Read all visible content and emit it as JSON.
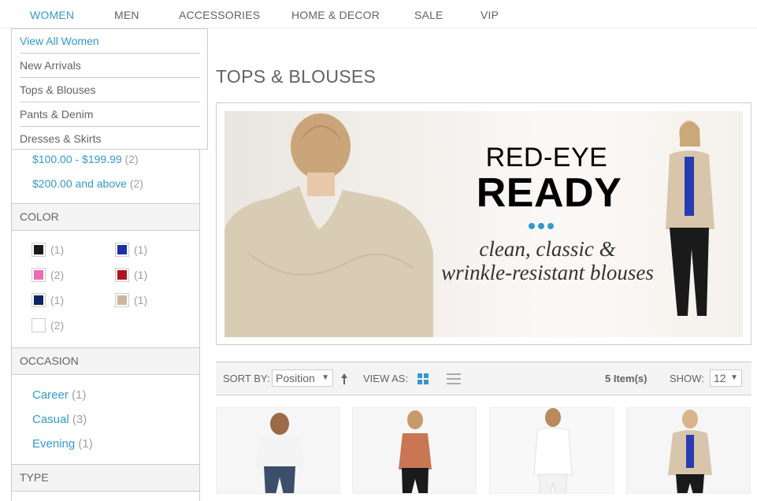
{
  "nav": {
    "items": [
      {
        "label": "WOMEN"
      },
      {
        "label": "MEN"
      },
      {
        "label": "ACCESSORIES"
      },
      {
        "label": "HOME & DECOR"
      },
      {
        "label": "SALE"
      },
      {
        "label": "VIP"
      }
    ],
    "active": "WOMEN"
  },
  "dropdown": {
    "items": [
      {
        "label": "View All Women"
      },
      {
        "label": "New Arrivals"
      },
      {
        "label": "Tops & Blouses"
      },
      {
        "label": "Pants & Denim"
      },
      {
        "label": "Dresses & Skirts"
      }
    ]
  },
  "sidebar": {
    "price": [
      {
        "label": "$100.00 - $199.99",
        "count": "(2)"
      },
      {
        "label": "$200.00 and above",
        "count": "(2)"
      }
    ],
    "color": {
      "title": "COLOR",
      "swatches": [
        {
          "color": "#1a1a1a",
          "count": "(1)"
        },
        {
          "color": "#1a2fa8",
          "count": "(1)"
        },
        {
          "color": "#f06ab4",
          "count": "(2)"
        },
        {
          "color": "#b0141e",
          "count": "(1)"
        },
        {
          "color": "#0f2466",
          "count": "(1)"
        },
        {
          "color": "#cbb89c",
          "count": "(1)"
        },
        {
          "color": "#ffffff",
          "count": "(2)"
        }
      ]
    },
    "occasion": {
      "title": "OCCASION",
      "items": [
        {
          "label": "Career",
          "count": "(1)"
        },
        {
          "label": "Casual",
          "count": "(3)"
        },
        {
          "label": "Evening",
          "count": "(1)"
        }
      ]
    },
    "type": {
      "title": "TYPE"
    }
  },
  "main": {
    "title": "TOPS & BLOUSES",
    "banner": {
      "line1": "RED-EYE",
      "line2": "READY",
      "tagline1": "clean, classic &",
      "tagline2": "wrinkle-resistant blouses"
    },
    "toolbar": {
      "sort_label": "SORT BY:",
      "sort_value": "Position",
      "view_label": "VIEW AS:",
      "count": "5 Item(s)",
      "show_label": "SHOW:",
      "show_value": "12"
    }
  },
  "products": [
    {
      "top_color": "#f4f4f4",
      "bottom_color": "#3b4f6b"
    },
    {
      "top_color": "#c87654",
      "bottom_color": "#1a1a1a"
    },
    {
      "top_color": "#ffffff",
      "bottom_color": "#f2f2f2"
    },
    {
      "top_color": "#d7c6ac",
      "bottom_color": "#1a1a1a"
    }
  ],
  "colors": {
    "accent": "#3399cc",
    "text": "#636363",
    "muted": "#a0a0a0"
  }
}
